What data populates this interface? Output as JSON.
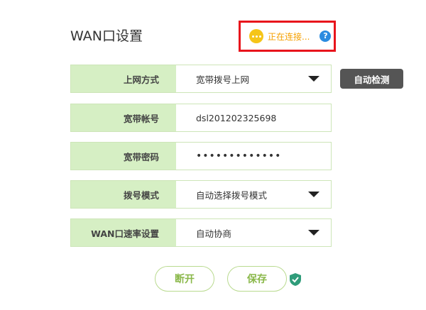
{
  "page": {
    "title": "WAN口设置"
  },
  "status": {
    "text": "正在连接...",
    "help": "?"
  },
  "fields": [
    {
      "label": "上网方式",
      "value": "宽带拨号上网",
      "dropdown": true
    },
    {
      "label": "宽带帐号",
      "value": "dsl201202325698",
      "dropdown": false
    },
    {
      "label": "宽带密码",
      "value": "•••••••••••••",
      "dropdown": false
    },
    {
      "label": "拨号模式",
      "value": "自动选择拨号模式",
      "dropdown": true
    },
    {
      "label": "WAN口速率设置",
      "value": "自动协商",
      "dropdown": true
    }
  ],
  "detect_button": "自动检测",
  "actions": {
    "disconnect": "断开",
    "save": "保存"
  },
  "colors": {
    "accent_green": "#8ab84a",
    "label_bg": "#d6efc4",
    "highlight_red": "#e8141c",
    "status_yellow": "#f5c518"
  }
}
